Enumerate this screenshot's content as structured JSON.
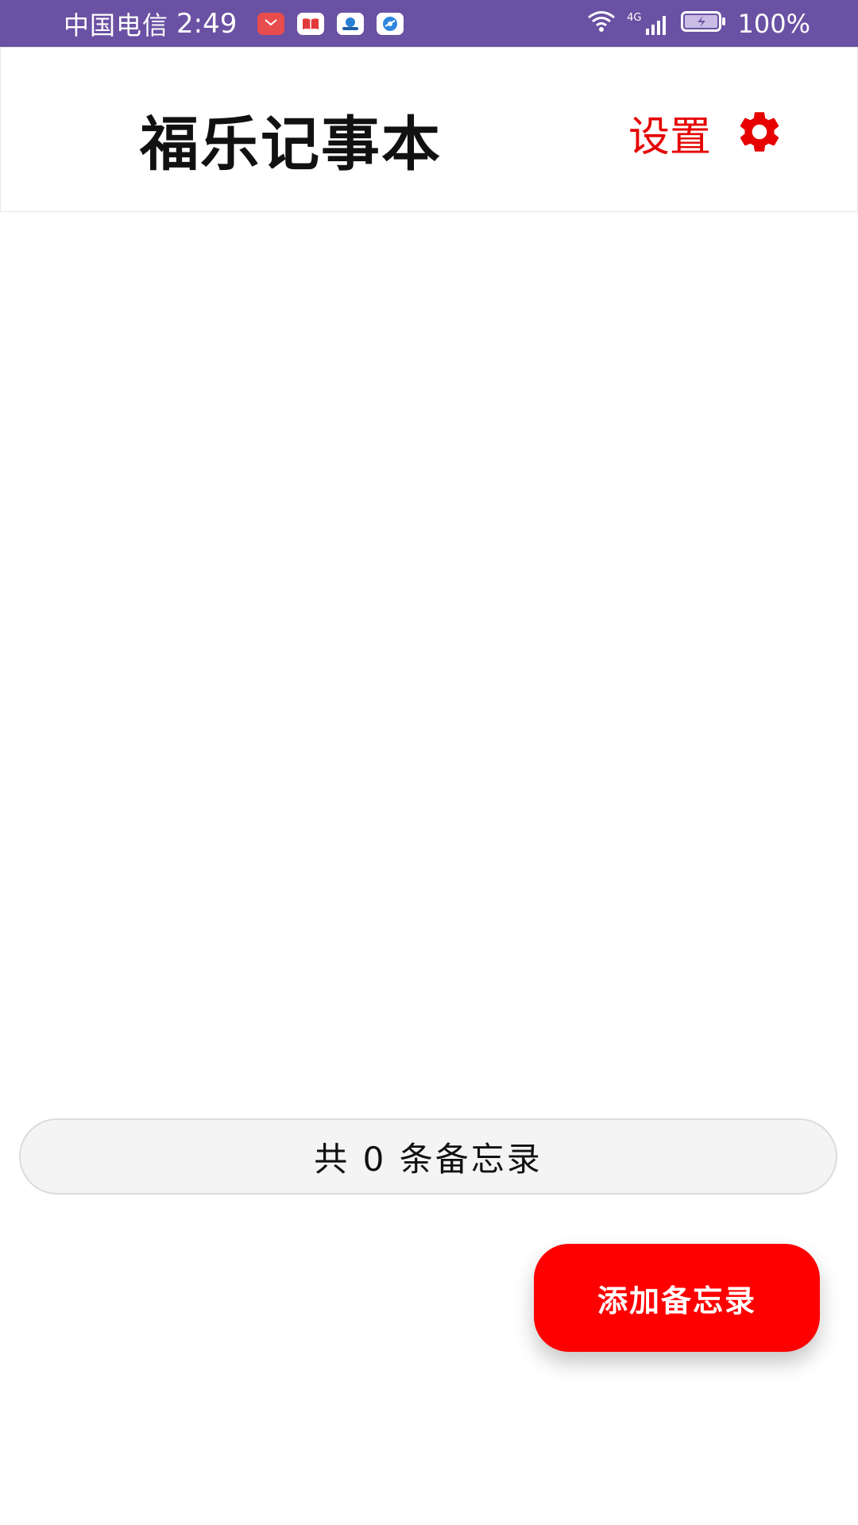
{
  "status_bar": {
    "carrier": "中国电信",
    "time": "2:49",
    "network": "4G",
    "battery": "100%",
    "bg_color": "#6a51a3",
    "notification_icons": [
      "huawei-store-icon",
      "book-icon",
      "cloud-app-icon",
      "browser-icon"
    ]
  },
  "header": {
    "title": "福乐记事本",
    "settings_label": "设置",
    "accent_color": "#e60000"
  },
  "footer": {
    "count_label": "共 0 条备忘录",
    "add_button_label": "添加备忘录",
    "add_button_color": "#ff0000"
  }
}
